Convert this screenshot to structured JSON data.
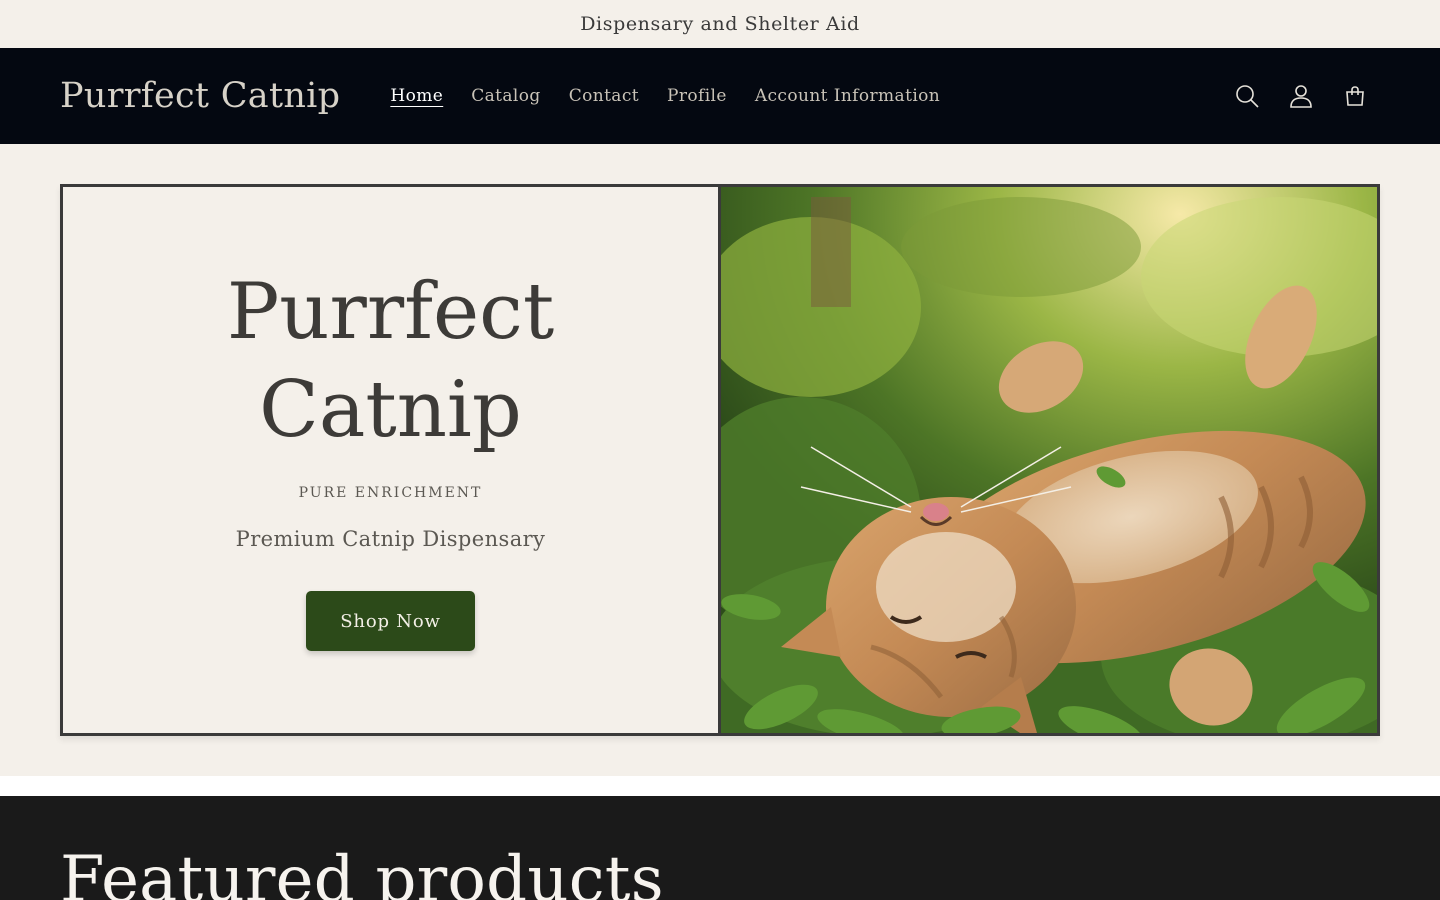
{
  "announcement": {
    "text": "Dispensary and Shelter Aid"
  },
  "header": {
    "logo": "Purrfect Catnip",
    "nav": [
      {
        "label": "Home",
        "active": true
      },
      {
        "label": "Catalog",
        "active": false
      },
      {
        "label": "Contact",
        "active": false
      },
      {
        "label": "Profile",
        "active": false
      },
      {
        "label": "Account Information",
        "active": false
      }
    ],
    "icons": [
      "search-icon",
      "account-icon",
      "cart-icon"
    ]
  },
  "hero": {
    "title": "Purrfect Catnip",
    "tagline": "PURE ENRICHMENT",
    "subtitle": "Premium Catnip Dispensary",
    "button_label": "Shop Now"
  },
  "featured": {
    "heading": "Featured products"
  },
  "colors": {
    "background": "#f4f0ea",
    "header_bg": "#040811",
    "button_bg": "#2c4a19",
    "featured_bg": "#1a1a1a"
  }
}
